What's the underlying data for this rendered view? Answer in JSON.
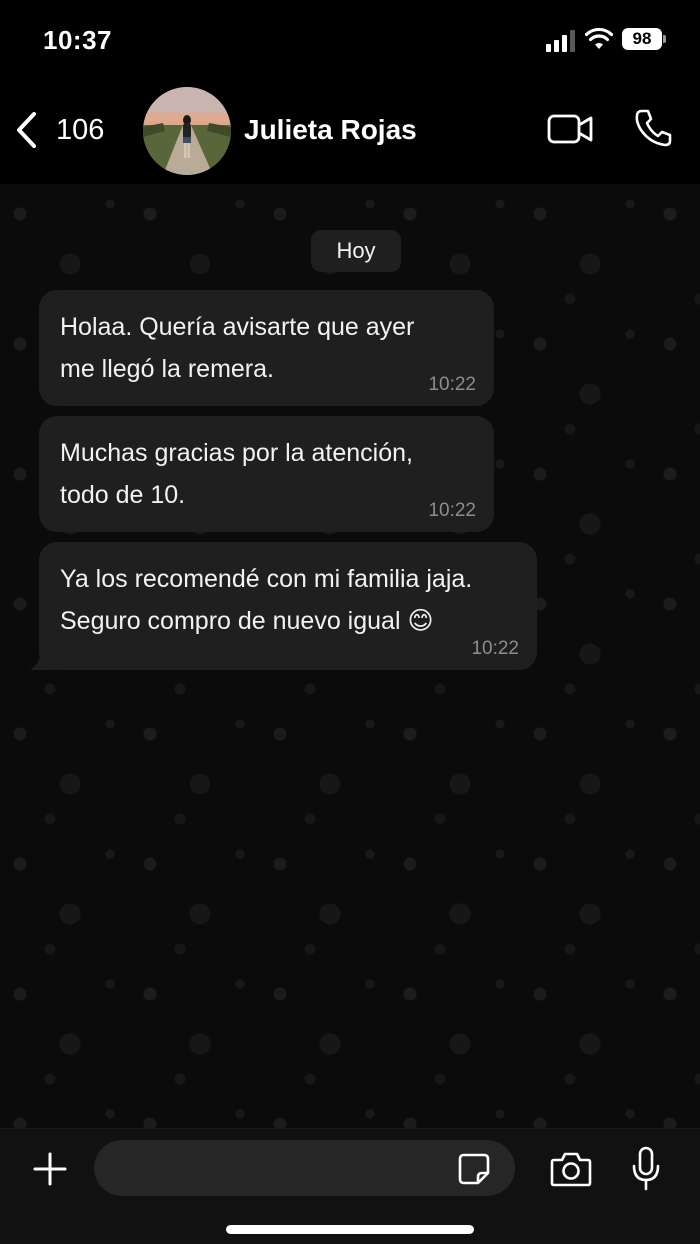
{
  "status_bar": {
    "time": "10:37",
    "battery": "98",
    "icons": [
      "signal-icon",
      "wifi-icon",
      "battery-icon"
    ]
  },
  "header": {
    "back_count": "106",
    "contact_name": "Julieta Rojas",
    "icons": [
      "chevron-left-icon",
      "video-camera-icon",
      "phone-icon"
    ]
  },
  "chat": {
    "date_label": "Hoy",
    "messages": [
      {
        "text": "Holaa. Quería avisarte que ayer\nme llegó la remera.",
        "time": "10:22"
      },
      {
        "text": "Muchas gracias por la atención,\ntodo de 10.",
        "time": "10:22"
      },
      {
        "text": "Ya los recomendé con mi familia jaja.\nSeguro compro de nuevo igual 😊",
        "time": "10:22"
      }
    ]
  },
  "input_bar": {
    "placeholder": "",
    "icons": [
      "plus-icon",
      "sticker-icon",
      "camera-icon",
      "microphone-icon"
    ]
  },
  "colors": {
    "background": "#000000",
    "bubble": "#1f1f1f",
    "timestamp": "#8d8d8d",
    "text": "#f2f2f2"
  }
}
